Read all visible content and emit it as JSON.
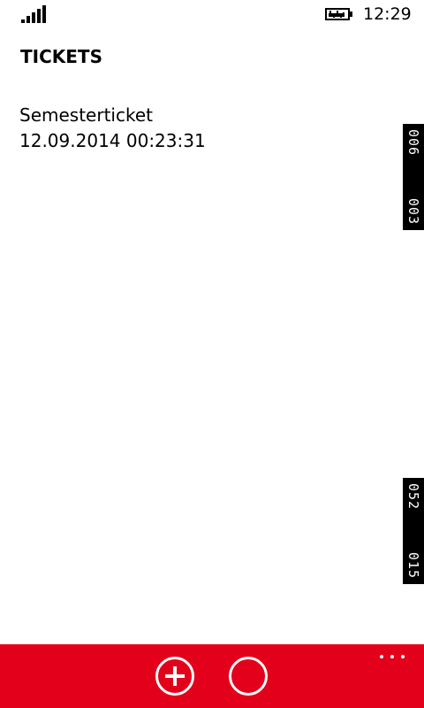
{
  "status_bar": {
    "time": "12:29",
    "signal_icon": "signal-strength-icon",
    "battery_icon": "battery-charging-icon"
  },
  "header": {
    "title": "TICKETS"
  },
  "tickets": [
    {
      "name": "Semesterticket",
      "date": "12.09.2014 00:23:31"
    }
  ],
  "side_tabs": [
    {
      "first": "006",
      "second": "003"
    },
    {
      "first": "052",
      "second": "015"
    }
  ],
  "app_bar": {
    "color": "#e3001b",
    "buttons": [
      {
        "icon": "add-icon"
      },
      {
        "icon": "circle-icon"
      }
    ],
    "more_icon": "more-dots-icon"
  }
}
